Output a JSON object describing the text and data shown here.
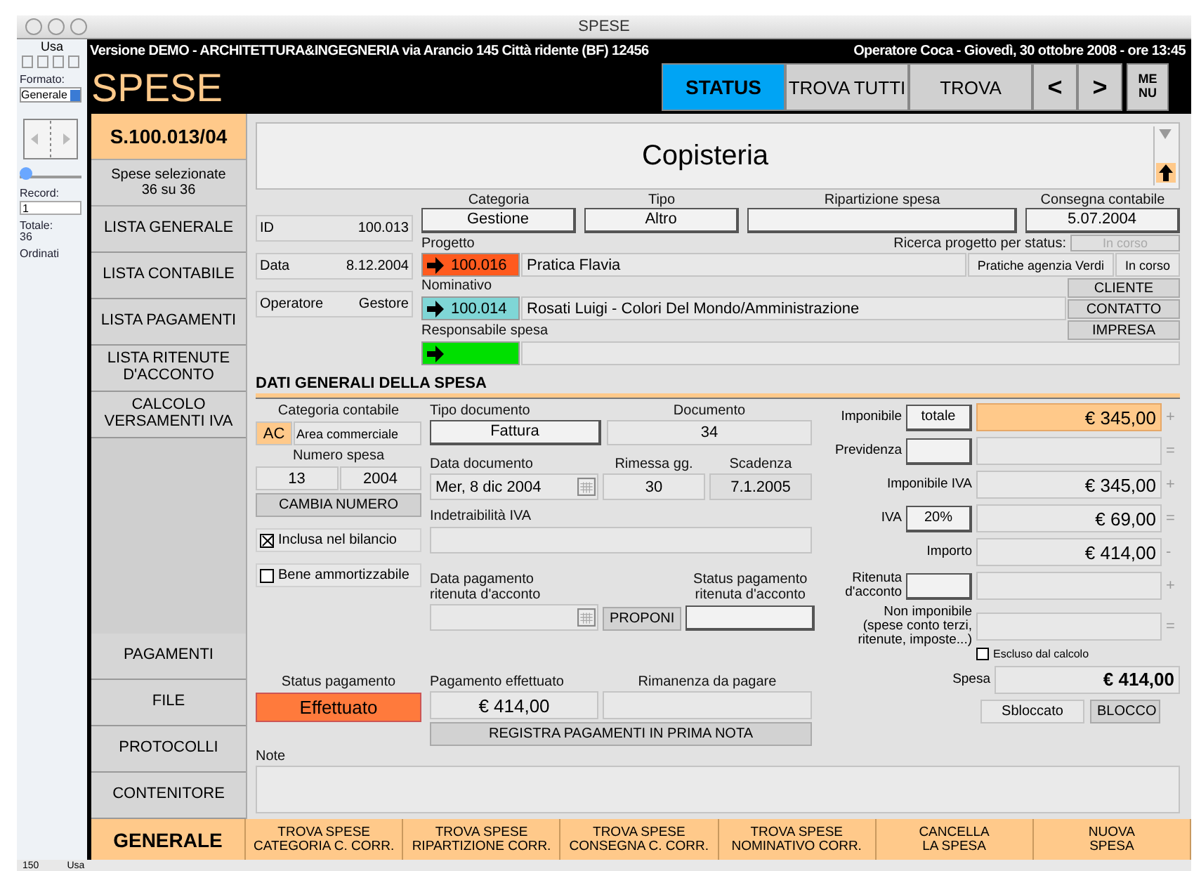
{
  "window": {
    "title": "SPESE"
  },
  "status_pane": {
    "mode": "Usa",
    "format_label": "Formato:",
    "format": "Generale",
    "record_label": "Record:",
    "record": "1",
    "total_label": "Totale:",
    "total": "36",
    "sort_state": "Ordinati",
    "slider": {
      "level": 0
    },
    "zoom": "150",
    "mode_bottom": "Usa"
  },
  "header": {
    "info": "Versione DEMO - ARCHITETTURA&INGEGNERIA via Arancio 145 Città ridente (BF) 12456",
    "operator": "Operatore Coca -  Giovedì, 30 ottobre 2008 - ore 13:45",
    "title": "SPESE",
    "buttons": [
      {
        "label": "STATUS",
        "selected": true,
        "kind": "wide"
      },
      {
        "label": "TROVA TUTTI",
        "selected": false,
        "kind": "wide"
      },
      {
        "label": "TROVA",
        "selected": false,
        "kind": "wide"
      },
      {
        "label": "<",
        "selected": false,
        "kind": "arrow"
      },
      {
        "label": ">",
        "selected": false,
        "kind": "arrow"
      },
      {
        "label": "ME\nNU",
        "selected": false,
        "kind": "menu"
      }
    ]
  },
  "sidebar": {
    "record_code": "S.100.013/04",
    "selection_label": "Spese selezionate",
    "selection_count": "36 su 36",
    "nav_top": [
      "LISTA GENERALE",
      "LISTA CONTABILE",
      "LISTA PAGAMENTI",
      "LISTA RITENUTE\nD'ACCONTO",
      "CALCOLO\nVERSAMENTI IVA"
    ],
    "nav_bottom": [
      "PAGAMENTI",
      "FILE",
      "PROTOCOLLI",
      "CONTENITORE"
    ]
  },
  "record": {
    "title": "Copisteria",
    "info": [
      {
        "label": "ID",
        "value": "100.013"
      },
      {
        "label": "Data",
        "value": "8.12.2004"
      },
      {
        "label": "Operatore",
        "value": "Gestore"
      }
    ],
    "classification": [
      {
        "label": "Categoria",
        "value": "Gestione"
      },
      {
        "label": "Tipo",
        "value": "Altro"
      },
      {
        "label": "Ripartizione spesa"
      },
      {
        "label": "Consegna contabile",
        "value": "5.07.2004"
      }
    ],
    "status_search": {
      "label": "Ricerca progetto per status:",
      "value": "In corso",
      "disabled": true
    },
    "links": [
      {
        "label": "Progetto",
        "code": "100.016",
        "name": "Pratica Flavia",
        "color": "#ff5a1e"
      },
      {
        "label": "Nominativo",
        "code": "100.014",
        "name": "Rosati Luigi - Colori Del Mondo/Amministrazione",
        "color": "#7fd6d6"
      },
      {
        "label": "Responsabile spesa",
        "color": "#00e000"
      }
    ],
    "project_agency": "Pratiche agenzia Verdi",
    "project_status": "In corso",
    "contact_buttons": [
      "CLIENTE",
      "CONTATTO",
      "IMPRESA"
    ]
  },
  "section_title": "DATI GENERALI DELLA SPESA",
  "accounting": {
    "category_label": "Categoria contabile",
    "category_code": "AC",
    "category_name": "Area commerciale",
    "number_label": "Numero spesa",
    "number": "13",
    "year": "2004",
    "change_button": "CAMBIA NUMERO",
    "checkboxes": [
      {
        "label": "Inclusa nel bilancio",
        "checked": true
      },
      {
        "label": "Bene ammortizzabile",
        "checked": false
      }
    ]
  },
  "document": {
    "type_label": "Tipo documento",
    "type": "Fattura",
    "doc_label": "Documento",
    "doc": "34",
    "date_label": "Data documento",
    "date": "Mer, 8 dic 2004",
    "days_label": "Rimessa gg.",
    "days": "30",
    "due_label": "Scadenza",
    "due": "7.1.2005",
    "vat_label": "Indetraibilità IVA",
    "withholding_date_label": "Data pagamento\nritenuta d'acconto",
    "propose_button": "PROPONI",
    "withholding_status_label": "Status pagamento\nritenuta d'acconto"
  },
  "amounts": {
    "rows": [
      {
        "label": "Imponibile",
        "kind": "button_field",
        "button": "totale",
        "value": "€ 345,00",
        "operator": "+",
        "highlighted": true
      },
      {
        "label": "Previdenza",
        "kind": "button_field",
        "operator": "=",
        "highlighted": false
      },
      {
        "label": "Imponibile IVA",
        "kind": "field",
        "value": "€ 345,00",
        "operator": "+",
        "highlighted": false
      },
      {
        "label": "IVA",
        "kind": "button_field",
        "button": "20%",
        "value": "€ 69,00",
        "operator": "=",
        "highlighted": false
      },
      {
        "label": "Importo",
        "kind": "field",
        "value": "€ 414,00",
        "operator": "-",
        "highlighted": false
      },
      {
        "label": "Ritenuta\nd'acconto",
        "kind": "button_field",
        "operator": "+",
        "highlighted": false
      },
      {
        "label": "Non imponibile\n(spese conto terzi,\nritenute, imposte...)",
        "kind": "field",
        "operator": "=",
        "highlighted": false,
        "exclude": {
          "label": "Escluso dal calcolo",
          "checked": false
        }
      },
      {
        "label": "Spesa",
        "kind": "total",
        "value": "€ 414,00",
        "highlighted": false
      }
    ],
    "lock_state": "Sbloccato",
    "lock_button": "BLOCCO"
  },
  "payment": {
    "status_label": "Status pagamento",
    "status": "Effettuato",
    "color": "#ff7a3c",
    "paid_label": "Pagamento effettuato",
    "paid": "€ 414,00",
    "remaining_label": "Rimanenza da pagare",
    "register_button": "REGISTRA PAGAMENTI IN PRIMA NOTA"
  },
  "note": {
    "label": "Note"
  },
  "footer": {
    "main": "GENERALE",
    "buttons": [
      "TROVA SPESE\nCATEGORIA C. CORR.",
      "TROVA SPESE\nRIPARTIZIONE CORR.",
      "TROVA SPESE\nCONSEGNA C. CORR.",
      "TROVA SPESE\nNOMINATIVO CORR.",
      "CANCELLA\nLA SPESA",
      "NUOVA\nSPESA"
    ]
  }
}
